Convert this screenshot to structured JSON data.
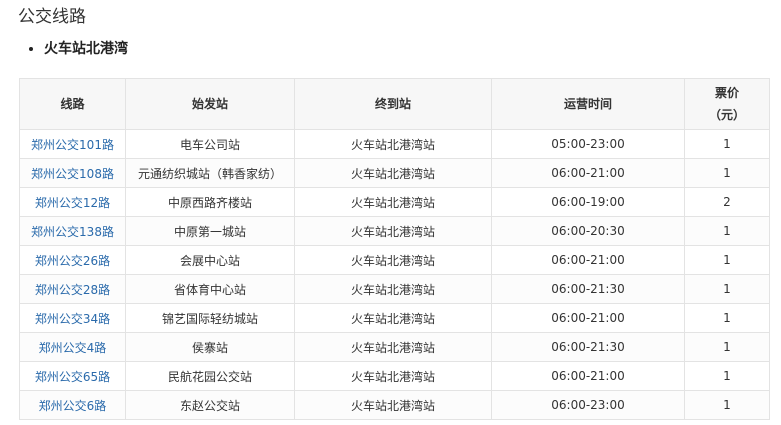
{
  "section_title": "公交线路",
  "stop_name": "火车站北港湾",
  "table": {
    "headers": {
      "line": "线路",
      "start": "始发站",
      "end": "终到站",
      "time": "运营时间",
      "fare_line1": "票价",
      "fare_line2": "（元）"
    },
    "rows": [
      {
        "line": "郑州公交101路",
        "start": "电车公司站",
        "end": "火车站北港湾站",
        "time": "05:00-23:00",
        "fare": "1"
      },
      {
        "line": "郑州公交108路",
        "start": "元通纺织城站（韩香家纺）",
        "end": "火车站北港湾站",
        "time": "06:00-21:00",
        "fare": "1"
      },
      {
        "line": "郑州公交12路",
        "start": "中原西路齐楼站",
        "end": "火车站北港湾站",
        "time": "06:00-19:00",
        "fare": "2"
      },
      {
        "line": "郑州公交138路",
        "start": "中原第一城站",
        "end": "火车站北港湾站",
        "time": "06:00-20:30",
        "fare": "1"
      },
      {
        "line": "郑州公交26路",
        "start": "会展中心站",
        "end": "火车站北港湾站",
        "time": "06:00-21:00",
        "fare": "1"
      },
      {
        "line": "郑州公交28路",
        "start": "省体育中心站",
        "end": "火车站北港湾站",
        "time": "06:00-21:30",
        "fare": "1"
      },
      {
        "line": "郑州公交34路",
        "start": "锦艺国际轻纺城站",
        "end": "火车站北港湾站",
        "time": "06:00-21:00",
        "fare": "1"
      },
      {
        "line": "郑州公交4路",
        "start": "侯寨站",
        "end": "火车站北港湾站",
        "time": "06:00-21:30",
        "fare": "1"
      },
      {
        "line": "郑州公交65路",
        "start": "民航花园公交站",
        "end": "火车站北港湾站",
        "time": "06:00-21:00",
        "fare": "1"
      },
      {
        "line": "郑州公交6路",
        "start": "东赵公交站",
        "end": "火车站北港湾站",
        "time": "06:00-23:00",
        "fare": "1"
      }
    ]
  }
}
